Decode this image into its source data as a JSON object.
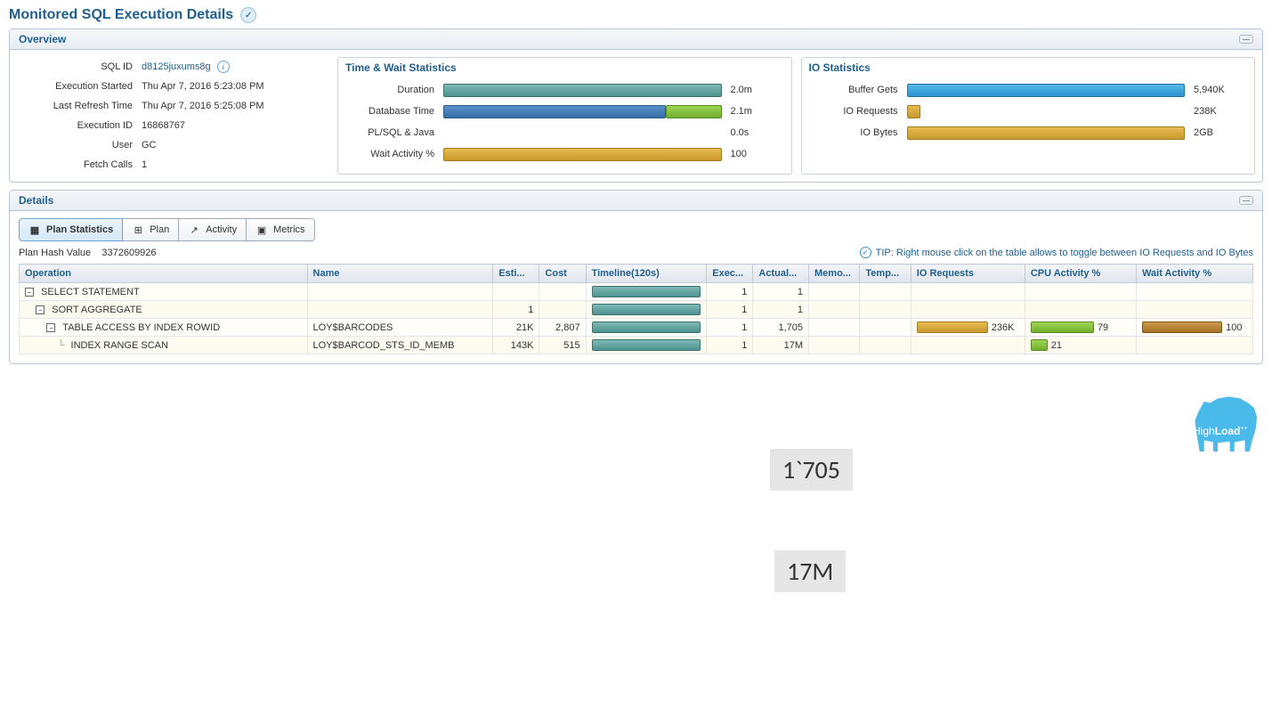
{
  "page_title": "Monitored SQL Execution Details",
  "overview": {
    "header": "Overview",
    "sql_id": {
      "label": "SQL ID",
      "value": "d8125juxums8g"
    },
    "execution_started": {
      "label": "Execution Started",
      "value": "Thu Apr 7, 2016 5:23:08 PM"
    },
    "last_refresh_time": {
      "label": "Last Refresh Time",
      "value": "Thu Apr 7, 2016 5:25:08 PM"
    },
    "execution_id": {
      "label": "Execution ID",
      "value": "16868767"
    },
    "user": {
      "label": "User",
      "value": "GC"
    },
    "fetch_calls": {
      "label": "Fetch Calls",
      "value": "1"
    }
  },
  "time_wait": {
    "header": "Time & Wait Statistics",
    "rows": [
      {
        "label": "Duration",
        "value": "2.0m",
        "kind": "teal",
        "pct": 100
      },
      {
        "label": "Database Time",
        "value": "2.1m",
        "kind": "dbtime",
        "blue_pct": 80,
        "green_pct": 20
      },
      {
        "label": "PL/SQL & Java",
        "value": "0.0s",
        "kind": "none",
        "pct": 0
      },
      {
        "label": "Wait Activity %",
        "value": "100",
        "kind": "gold",
        "pct": 100
      }
    ]
  },
  "io_stats": {
    "header": "IO Statistics",
    "rows": [
      {
        "label": "Buffer Gets",
        "value": "5,940K",
        "kind": "lightblue",
        "pct": 100
      },
      {
        "label": "IO Requests",
        "value": "238K",
        "kind": "gold",
        "pct": 5
      },
      {
        "label": "IO Bytes",
        "value": "2GB",
        "kind": "gold",
        "pct": 100
      }
    ]
  },
  "details": {
    "header": "Details",
    "tabs": [
      {
        "label": "Plan Statistics",
        "active": true
      },
      {
        "label": "Plan",
        "active": false
      },
      {
        "label": "Activity",
        "active": false
      },
      {
        "label": "Metrics",
        "active": false
      }
    ],
    "plan_hash_label": "Plan Hash Value",
    "plan_hash_value": "3372609926",
    "tip": "TIP: Right mouse click on the table allows to toggle between IO Requests and IO Bytes",
    "columns": [
      "Operation",
      "Name",
      "Esti...",
      "Cost",
      "Timeline(120s)",
      "Exec...",
      "Actual...",
      "Memo...",
      "Temp...",
      "IO Requests",
      "CPU Activity %",
      "Wait Activity %"
    ],
    "rows": [
      {
        "indent": 0,
        "toggle": true,
        "operation": "SELECT STATEMENT",
        "name": "",
        "est": "",
        "cost": "",
        "tl_pct": 100,
        "exec": "1",
        "actual": "1",
        "io_req": "",
        "io_pct": 0,
        "cpu": "",
        "cpu_pct": 0,
        "wait": "",
        "wait_pct": 0
      },
      {
        "indent": 1,
        "toggle": true,
        "operation": "SORT AGGREGATE",
        "name": "",
        "est": "1",
        "cost": "",
        "tl_pct": 100,
        "exec": "1",
        "actual": "1",
        "io_req": "",
        "io_pct": 0,
        "cpu": "",
        "cpu_pct": 0,
        "wait": "",
        "wait_pct": 0
      },
      {
        "indent": 2,
        "toggle": true,
        "operation": "TABLE ACCESS BY INDEX ROWID",
        "name": "LOY$BARCODES",
        "est": "21K",
        "cost": "2,807",
        "tl_pct": 100,
        "exec": "1",
        "actual": "1,705",
        "io_req": "236K",
        "io_pct": 100,
        "cpu": "79",
        "cpu_pct": 79,
        "wait": "100",
        "wait_pct": 100
      },
      {
        "indent": 3,
        "toggle": false,
        "operation": "INDEX RANGE SCAN",
        "name": "LOY$BARCOD_STS_ID_MEMB",
        "est": "143K",
        "cost": "515",
        "tl_pct": 100,
        "exec": "1",
        "actual": "17M",
        "io_req": "",
        "io_pct": 0,
        "cpu": "21",
        "cpu_pct": 21,
        "wait": "",
        "wait_pct": 0
      }
    ]
  },
  "annotations": {
    "a1": "1`705",
    "a2": "17M"
  },
  "footer": {
    "brand_prefix": "High",
    "brand_bold": "Load",
    "brand_suffix": "++"
  }
}
